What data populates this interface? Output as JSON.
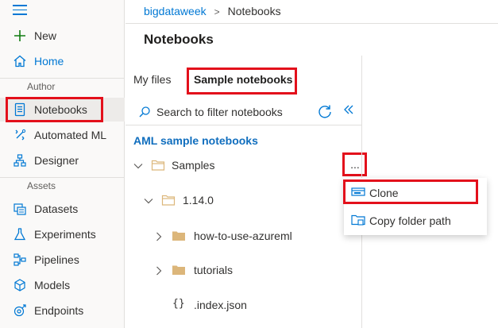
{
  "sidebar": {
    "new_label": "New",
    "home_label": "Home",
    "author_section": "Author",
    "notebooks_label": "Notebooks",
    "automated_ml_label": "Automated ML",
    "designer_label": "Designer",
    "assets_section": "Assets",
    "datasets_label": "Datasets",
    "experiments_label": "Experiments",
    "pipelines_label": "Pipelines",
    "models_label": "Models",
    "endpoints_label": "Endpoints"
  },
  "breadcrumb": {
    "workspace": "bigdataweek",
    "current": "Notebooks"
  },
  "page_title": "Notebooks",
  "tabs": {
    "my_files": "My files",
    "sample_notebooks": "Sample notebooks"
  },
  "search": {
    "placeholder": "Search to filter notebooks"
  },
  "section_heading": "AML sample notebooks",
  "tree": {
    "samples": "Samples",
    "version": "1.14.0",
    "how_to": "how-to-use-azureml",
    "tutorials": "tutorials",
    "index_json": ".index.json",
    "json_glyph": "{}"
  },
  "more_button": "...",
  "context_menu": {
    "clone": "Clone",
    "copy_path": "Copy folder path"
  },
  "colors": {
    "accent": "#0078d4",
    "highlight": "#e3101b",
    "folder": "#dcb67a"
  }
}
